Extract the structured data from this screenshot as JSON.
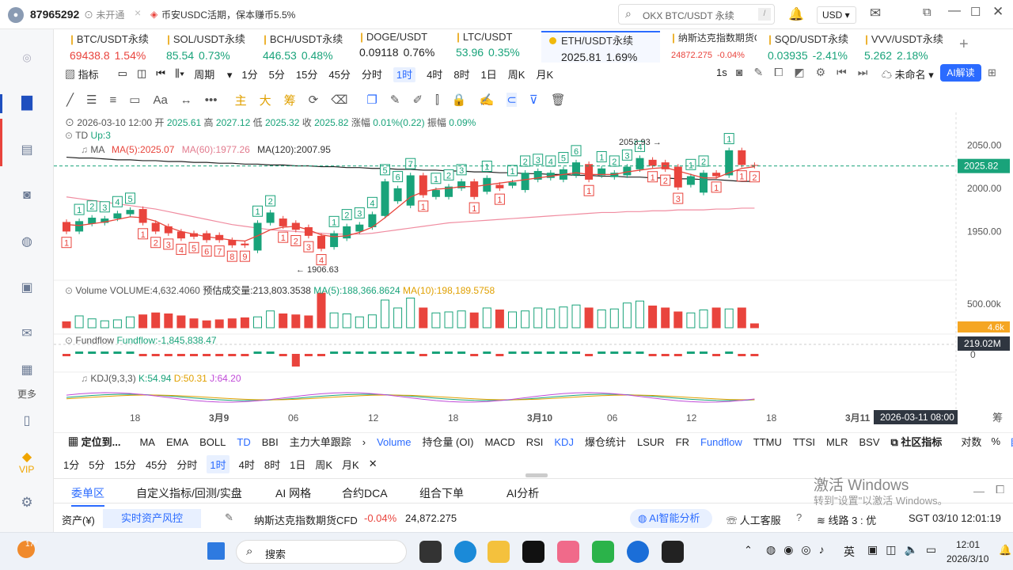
{
  "topbar": {
    "user_id": "87965292",
    "badge": "未开通",
    "promo": "币安USDC活期，保本赚币5.5%",
    "search_placeholder": "OKX BTC/USDT 永续",
    "search_key": "/",
    "currency": "USD"
  },
  "tickers": [
    {
      "name": "BTC/USDT永续",
      "price": "69438.8",
      "change": "1.54%",
      "dir": "dn",
      "x": 10,
      "w": 118,
      "dot": false
    },
    {
      "name": "SOL/USDT永续",
      "price": "85.54",
      "change": "0.73%",
      "dir": "up",
      "x": 132,
      "w": 118,
      "dot": false
    },
    {
      "name": "BCH/USDT永续",
      "price": "446.53",
      "change": "0.48%",
      "dir": "up",
      "x": 254,
      "w": 118,
      "dot": false
    },
    {
      "name": "DOGE/USDT",
      "price": "0.09118",
      "change": "0.76%",
      "dir": "",
      "x": 376,
      "w": 118,
      "dot": false
    },
    {
      "name": "LTC/USDT",
      "price": "53.96",
      "change": "0.35%",
      "dir": "up",
      "x": 498,
      "w": 118,
      "dot": false
    },
    {
      "name": "ETH/USDT永续",
      "price": "2025.81",
      "change": "1.69%",
      "dir": "",
      "x": 616,
      "w": 150,
      "dot": true,
      "active": true
    },
    {
      "name": "纳斯达克指数期货C",
      "price": "24872.275",
      "change": "-0.04%",
      "dir": "dn",
      "x": 770,
      "w": 118,
      "dot": false,
      "small": true
    },
    {
      "name": "SQD/USDT永续",
      "price": "0.03935",
      "change": "-2.41%",
      "dir": "up",
      "x": 892,
      "w": 118,
      "dot": false
    },
    {
      "name": "VVV/USDT永续",
      "price": "5.262",
      "change": "2.18%",
      "dir": "up",
      "x": 1014,
      "w": 118,
      "dot": false
    }
  ],
  "toolbar1": {
    "indicators": "指标",
    "period": "周期",
    "periods": [
      "1分",
      "5分",
      "15分",
      "45分",
      "分时",
      "1时",
      "4时",
      "8时",
      "1日",
      "周K",
      "月K"
    ],
    "active_period": "1时",
    "right_1s": "1s",
    "unnamed": "未命名",
    "ai_btn": "AI解读"
  },
  "toolbar2": {
    "zhu": "主",
    "da": "大",
    "chou": "筹"
  },
  "legend": {
    "date": "2026-03-10 12:00",
    "open_l": "开",
    "open": "2025.61",
    "high_l": "高",
    "high": "2027.12",
    "low_l": "低",
    "low": "2025.32",
    "close_l": "收",
    "close": "2025.82",
    "chg_l": "涨幅",
    "chg": "0.01%(0.22)",
    "amp_l": "振幅",
    "amp": "0.09%",
    "td": "TD",
    "td_val": "Up:3",
    "ma": "MA",
    "ma5": "MA(5):2025.07",
    "ma60": "MA(60):1977.26",
    "ma120": "MA(120):2007.95"
  },
  "price_axis": [
    "2050.00",
    "2000.00",
    "1950.00"
  ],
  "current_price": "2025.82",
  "high_mark": "2053.93",
  "low_mark": "1906.63",
  "volume": {
    "label": "Volume",
    "vol": "VOLUME:4,632.4060",
    "est": "预估成交量:213,803.3538",
    "ma5": "MA(5):188,366.8624",
    "ma10": "MA(10):198,189.5758",
    "axis": "500.00k",
    "badge": "4.6k"
  },
  "fundflow": {
    "label": "Fundflow",
    "val": "Fundflow:-1,845,838.47",
    "axis": "0",
    "badge": "219.02M"
  },
  "kdj": {
    "label": "KDJ(9,3,3)",
    "k": "K:54.94",
    "d": "D:50.31",
    "j": "J:64.20"
  },
  "time_axis": [
    {
      "t": "18",
      "x": 102
    },
    {
      "t": "3月9",
      "x": 202
    },
    {
      "t": "06",
      "x": 302
    },
    {
      "t": "12",
      "x": 403
    },
    {
      "t": "18",
      "x": 504
    },
    {
      "t": "3月10",
      "x": 604
    },
    {
      "t": "06",
      "x": 705
    },
    {
      "t": "12",
      "x": 805
    },
    {
      "t": "18",
      "x": 906
    },
    {
      "t": "3月11",
      "x": 1006
    }
  ],
  "cursor_time": "2026-03-11 08:00",
  "chou_label": "筹",
  "indbar": {
    "locate": "定位到...",
    "items": [
      "MA",
      "EMA",
      "BOLL",
      "TD",
      "BBI",
      "主力大单跟踪",
      "Volume",
      "持仓量 (OI)",
      "MACD",
      "RSI",
      "KDJ",
      "爆仓统计",
      "LSUR",
      "FR",
      "Fundflow",
      "TTMU",
      "TTSI",
      "MLR",
      "BSV"
    ],
    "community": "社区指标",
    "right": [
      "对数",
      "%",
      "自动"
    ]
  },
  "period_row": [
    "1分",
    "5分",
    "15分",
    "45分",
    "分时",
    "1时",
    "4时",
    "8时",
    "1日",
    "周K",
    "月K"
  ],
  "tabs": [
    "委单区",
    "自定义指标/回测/实盘",
    "AI 网格",
    "合约DCA",
    "组合下单",
    "AI分析"
  ],
  "bottom": {
    "assets": "资产(¥)",
    "risk": "实时资产风控",
    "cfd_name": "纳斯达克指数期货CFD",
    "cfd_chg": "-0.04%",
    "cfd_price": "24,872.275",
    "ai": "AI智能分析",
    "service": "人工客服",
    "line": "线路 3 : 优",
    "clock": "SGT 03/10 12:01:19"
  },
  "watermark": {
    "t1": "激活 Windows",
    "t2": "转到\"设置\"以激活 Windows。"
  },
  "sidebar": {
    "more": "更多",
    "vip": "VIP"
  },
  "taskbar": {
    "temp": "17°",
    "search": "搜索",
    "lang": "英",
    "time": "12:01",
    "date": "2026/3/10"
  },
  "chart_data": {
    "type": "candlestick",
    "candles": [
      [
        1961,
        1950
      ],
      [
        1950,
        1962
      ],
      [
        1959,
        1966
      ],
      [
        1960,
        1965
      ],
      [
        1965,
        1971
      ],
      [
        1970,
        1975
      ],
      [
        1976,
        1960
      ],
      [
        1960,
        1950
      ],
      [
        1956,
        1948
      ],
      [
        1950,
        1942
      ],
      [
        1948,
        1944
      ],
      [
        1948,
        1940
      ],
      [
        1946,
        1940
      ],
      [
        1940,
        1934
      ],
      [
        1936,
        1934
      ],
      [
        1928,
        1960
      ],
      [
        1960,
        1972
      ],
      [
        1965,
        1956
      ],
      [
        1960,
        1952
      ],
      [
        1955,
        1945
      ],
      [
        1945,
        1930
      ],
      [
        1932,
        1948
      ],
      [
        1942,
        1956
      ],
      [
        1950,
        1958
      ],
      [
        1955,
        1970
      ],
      [
        1968,
        2008
      ],
      [
        1985,
        2000
      ],
      [
        1980,
        2015
      ],
      [
        2015,
        1992
      ],
      [
        1990,
        1998
      ],
      [
        1990,
        2002
      ],
      [
        2000,
        2008
      ],
      [
        2008,
        1990
      ],
      [
        1996,
        2012
      ],
      [
        2004,
        2000
      ],
      [
        2003,
        2007
      ],
      [
        1998,
        2018
      ],
      [
        2010,
        2020
      ],
      [
        2012,
        2018
      ],
      [
        2010,
        2022
      ],
      [
        2015,
        2030
      ],
      [
        2028,
        2010
      ],
      [
        2015,
        2023
      ],
      [
        2013,
        2018
      ],
      [
        2015,
        2025
      ],
      [
        2022,
        2035
      ],
      [
        2033,
        2026
      ],
      [
        2030,
        2022
      ],
      [
        2025,
        2001
      ],
      [
        2004,
        2014
      ],
      [
        1995,
        2018
      ],
      [
        2018,
        2014
      ],
      [
        2015,
        2044
      ],
      [
        2044,
        2027
      ],
      [
        2027,
        2026
      ]
    ],
    "ma5": [
      1958,
      1957,
      1959,
      1961,
      1964,
      1967,
      1966,
      1962,
      1955,
      1950,
      1947,
      1944,
      1942,
      1940,
      1939,
      1945,
      1952,
      1955,
      1956,
      1952,
      1946,
      1944,
      1945,
      1949,
      1955,
      1966,
      1978,
      1990,
      1996,
      1999,
      2000,
      2002,
      2002,
      2004,
      2006,
      2008,
      2010,
      2012,
      2014,
      2016,
      2018,
      2016,
      2016,
      2016,
      2019,
      2021,
      2023,
      2024,
      2020,
      2016,
      2012,
      2012,
      2018,
      2023,
      2025
    ],
    "ma60": [
      1990,
      1988,
      1986,
      1984,
      1982,
      1980,
      1978,
      1976,
      1973,
      1970,
      1967,
      1964,
      1961,
      1958,
      1956,
      1954,
      1952,
      1951,
      1950,
      1949,
      1948,
      1947,
      1947,
      1947,
      1948,
      1950,
      1952,
      1954,
      1956,
      1958,
      1960,
      1961,
      1962,
      1963,
      1964,
      1965,
      1966,
      1967,
      1968,
      1969,
      1970,
      1971,
      1972,
      1972,
      1973,
      1973,
      1974,
      1974,
      1975,
      1975,
      1975,
      1976,
      1976,
      1977,
      1977
    ],
    "ma120": [
      2036,
      2035,
      2035,
      2034,
      2033,
      2033,
      2032,
      2032,
      2031,
      2031,
      2030,
      2030,
      2029,
      2029,
      2028,
      2028,
      2027,
      2027,
      2026,
      2026,
      2025,
      2025,
      2024,
      2024,
      2023,
      2023,
      2022,
      2022,
      2021,
      2021,
      2020,
      2020,
      2019,
      2019,
      2018,
      2018,
      2017,
      2017,
      2016,
      2016,
      2015,
      2015,
      2014,
      2014,
      2013,
      2013,
      2012,
      2012,
      2011,
      2011,
      2010,
      2010,
      2009,
      2008,
      2008
    ],
    "volume": [
      60,
      120,
      90,
      70,
      80,
      110,
      130,
      150,
      140,
      120,
      90,
      70,
      80,
      90,
      100,
      110,
      170,
      140,
      130,
      120,
      350,
      150,
      140,
      110,
      130,
      280,
      200,
      300,
      200,
      150,
      160,
      170,
      150,
      200,
      180,
      160,
      170,
      200,
      190,
      210,
      230,
      200,
      180,
      190,
      250,
      270,
      220,
      200,
      160,
      150,
      180,
      200,
      190,
      200,
      40
    ],
    "ylim": [
      1900,
      2075
    ]
  },
  "colors": {
    "up": "#19a37a",
    "down": "#e9443d",
    "accent": "#2b6bff",
    "ma5": "#e8453c",
    "ma60": "#f08ca0",
    "ma120": "#222222"
  }
}
